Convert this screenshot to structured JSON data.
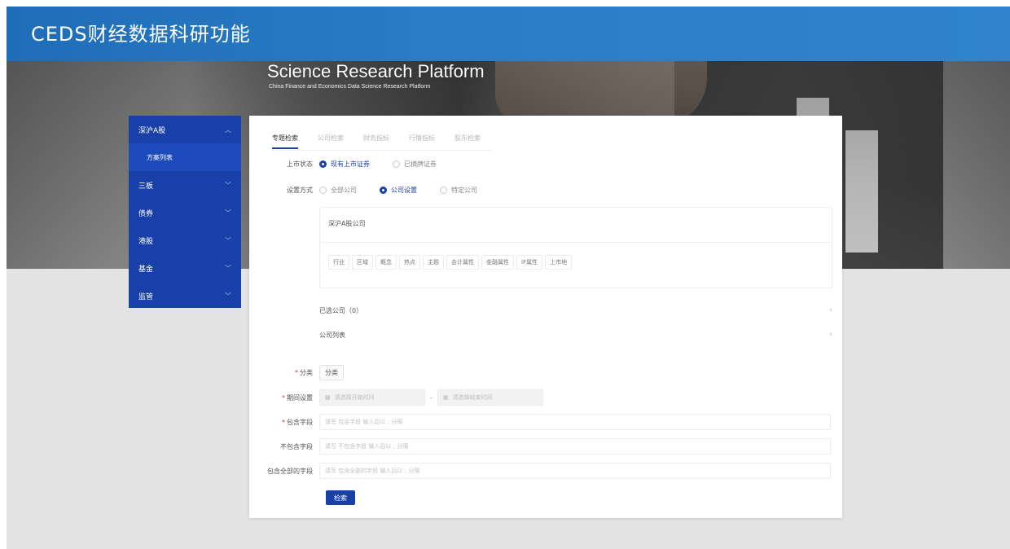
{
  "app": {
    "title": "CEDS财经数据科研功能"
  },
  "hero": {
    "title": "Science Research Platform",
    "subtitle": "China Finance and Economics Data Science Research Platform"
  },
  "sidebar": {
    "items": [
      {
        "label": "深沪A股",
        "expanded": true
      },
      {
        "label": "方案列表",
        "sub": true
      },
      {
        "label": "三板"
      },
      {
        "label": "债券"
      },
      {
        "label": "港股"
      },
      {
        "label": "基金"
      },
      {
        "label": "监管"
      }
    ]
  },
  "tabs": [
    {
      "label": "专题检索",
      "active": true
    },
    {
      "label": "公司检索"
    },
    {
      "label": "财务指标"
    },
    {
      "label": "行情指标"
    },
    {
      "label": "股东检索"
    }
  ],
  "listing_status": {
    "label": "上市状态",
    "options": [
      {
        "label": "现有上市证券",
        "checked": true
      },
      {
        "label": "已摘牌证券",
        "checked": false
      }
    ]
  },
  "selection_method": {
    "label": "设置方式",
    "options": [
      {
        "label": "全部公司",
        "checked": false
      },
      {
        "label": "公司设置",
        "checked": true
      },
      {
        "label": "特定公司",
        "checked": false
      }
    ]
  },
  "company_box": {
    "title": "深沪A股公司",
    "filters": [
      "行业",
      "区域",
      "概念",
      "热点",
      "主题",
      "会计属性",
      "金融属性",
      "IF属性",
      "上市地"
    ]
  },
  "selected_companies": {
    "label": "已选公司（0）"
  },
  "company_list": {
    "label": "公司列表"
  },
  "form": {
    "category": {
      "label": "分类",
      "button": "分类"
    },
    "period": {
      "label": "期间设置",
      "start_placeholder": "请选择开始时间",
      "separator": "-",
      "end_placeholder": "请选择结束时间"
    },
    "include_fields": {
      "label": "包含字段",
      "placeholder": "请写 包含字段 输入后以 ; 分隔"
    },
    "exclude_fields": {
      "label": "不包含字段",
      "placeholder": "请写 不包含字段 输入后以 ; 分隔"
    },
    "include_all_fields": {
      "label": "包含全部的字段",
      "placeholder": "请写 包含全部的字段 输入后以 ; 分隔"
    },
    "submit_label": "检索"
  },
  "colors": {
    "brand": "#1940a8",
    "banner": "#2a7dc7"
  }
}
